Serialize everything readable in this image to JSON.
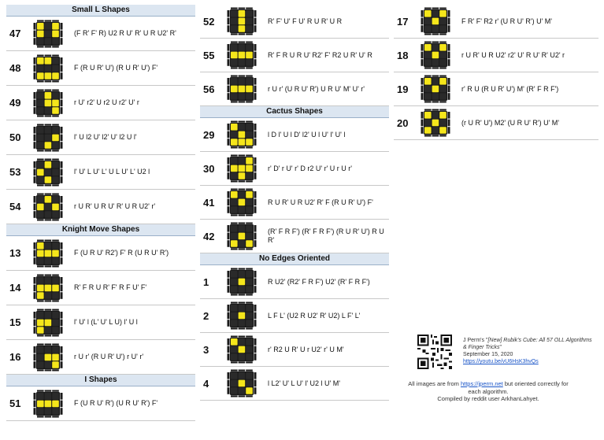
{
  "columns": [
    {
      "sections": [
        {
          "title": "Small L Shapes",
          "rows": [
            {
              "num": "47",
              "alg": "(F R' F' R) U2 R U' R' U R U2' R'",
              "pattern": [
                "101",
                "101",
                "000"
              ]
            },
            {
              "num": "48",
              "alg": "F (R U R' U') (R U R' U') F'",
              "pattern": [
                "110",
                "000",
                "111"
              ]
            },
            {
              "num": "49",
              "alg": "r U' r2' U r2 U r2' U' r",
              "pattern": [
                "010",
                "011",
                "001"
              ]
            },
            {
              "num": "50",
              "alg": "l' U l2 U' l2' U' l2 U l'",
              "pattern": [
                "000",
                "001",
                "010"
              ]
            },
            {
              "num": "53",
              "alg": "l' U' L U' L' U L U' L' U2 l",
              "pattern": [
                "010",
                "100",
                "010"
              ]
            },
            {
              "num": "54",
              "alg": "r U R' U R U' R' U R U2' r'",
              "pattern": [
                "010",
                "101",
                "000"
              ]
            }
          ]
        },
        {
          "title": "Knight Move Shapes",
          "rows": [
            {
              "num": "13",
              "alg": "F (U R U' R2') F' R (U R U' R')",
              "pattern": [
                "100",
                "111",
                "000"
              ]
            },
            {
              "num": "14",
              "alg": "R' F R U R' F' R F U' F'",
              "pattern": [
                "000",
                "111",
                "100"
              ]
            },
            {
              "num": "15",
              "alg": "l' U' l (L' U' L U) l' U l",
              "pattern": [
                "000",
                "110",
                "100"
              ]
            },
            {
              "num": "16",
              "alg": "r U r' (R U R' U') r U' r'",
              "pattern": [
                "000",
                "011",
                "001"
              ]
            }
          ]
        },
        {
          "title": "I Shapes",
          "rows": [
            {
              "num": "51",
              "alg": "F (U R U' R') (U R U' R') F'",
              "pattern": [
                "000",
                "111",
                "000"
              ]
            }
          ]
        }
      ]
    },
    {
      "sections": [
        {
          "title": "",
          "rows": [
            {
              "num": "52",
              "alg": "R' F' U' F U' R U R' U R",
              "pattern": [
                "010",
                "010",
                "010"
              ]
            },
            {
              "num": "55",
              "alg": "R' F R U R U' R2' F' R2 U R' U' R",
              "pattern": [
                "000",
                "111",
                "000"
              ]
            },
            {
              "num": "56",
              "alg": "r U r' (U R U' R') U R U' M' U' r'",
              "pattern": [
                "000",
                "111",
                "000"
              ]
            }
          ]
        },
        {
          "title": "Cactus Shapes",
          "rows": [
            {
              "num": "29",
              "alg": "l D l' U l D' l2' U l U' l' U' l",
              "pattern": [
                "100",
                "010",
                "111"
              ]
            },
            {
              "num": "30",
              "alg": "r' D' r U' r' D r2 U' r' U r U r'",
              "pattern": [
                "001",
                "111",
                "010"
              ]
            },
            {
              "num": "41",
              "alg": "R U R' U R U2' R' F (R U R' U') F'",
              "pattern": [
                "101",
                "010",
                "000"
              ]
            },
            {
              "num": "42",
              "alg": "(R' F R F') (R' F R F') (R U R' U') R U R'",
              "pattern": [
                "000",
                "010",
                "101"
              ]
            }
          ]
        },
        {
          "title": "No Edges Oriented",
          "rows": [
            {
              "num": "1",
              "alg": "R U2' (R2' F R F') U2' (R' F R F')",
              "pattern": [
                "000",
                "010",
                "000"
              ]
            },
            {
              "num": "2",
              "alg": "L F L' (U2 R U2' R' U2) L F' L'",
              "pattern": [
                "000",
                "010",
                "000"
              ]
            },
            {
              "num": "3",
              "alg": "r' R2 U R' U r U2' r' U M'",
              "pattern": [
                "100",
                "010",
                "000"
              ]
            },
            {
              "num": "4",
              "alg": "l L2' U' L U' l' U2 l U' M'",
              "pattern": [
                "000",
                "010",
                "001"
              ]
            }
          ]
        }
      ]
    },
    {
      "sections": [
        {
          "title": "",
          "rows": [
            {
              "num": "17",
              "alg": "F R' F' R2 r' (U R U' R') U' M'",
              "pattern": [
                "101",
                "010",
                "000"
              ]
            },
            {
              "num": "18",
              "alg": "r U R' U R U2' r2' U' R U' R' U2' r",
              "pattern": [
                "101",
                "010",
                "000"
              ]
            },
            {
              "num": "19",
              "alg": "r' R U (R U R' U') M' (R' F R F')",
              "pattern": [
                "101",
                "010",
                "000"
              ]
            },
            {
              "num": "20",
              "alg": "(r U R' U') M2' (U R U' R') U' M'",
              "pattern": [
                "101",
                "010",
                "101"
              ]
            }
          ]
        }
      ]
    }
  ],
  "credit": {
    "line1": "J Perm's \"",
    "title": "[New] Rubik's Cube: All 57 OLL Algorithms & Finger Tricks",
    "line1_end": "\"",
    "date": "September 15, 2020",
    "url": "https://youtu.be/vU6HsK3hvQs"
  },
  "footer": {
    "prefix": "All images are from ",
    "site": "https://jperm.net",
    "suffix": " but oriented correctly for each algorithm.",
    "compiled": "Compiled by reddit user ArkhanLahyet."
  },
  "colors": {
    "yellow": "#f5e61b",
    "dark": "#2a2a2a",
    "header_bg": "#dce6f1"
  }
}
